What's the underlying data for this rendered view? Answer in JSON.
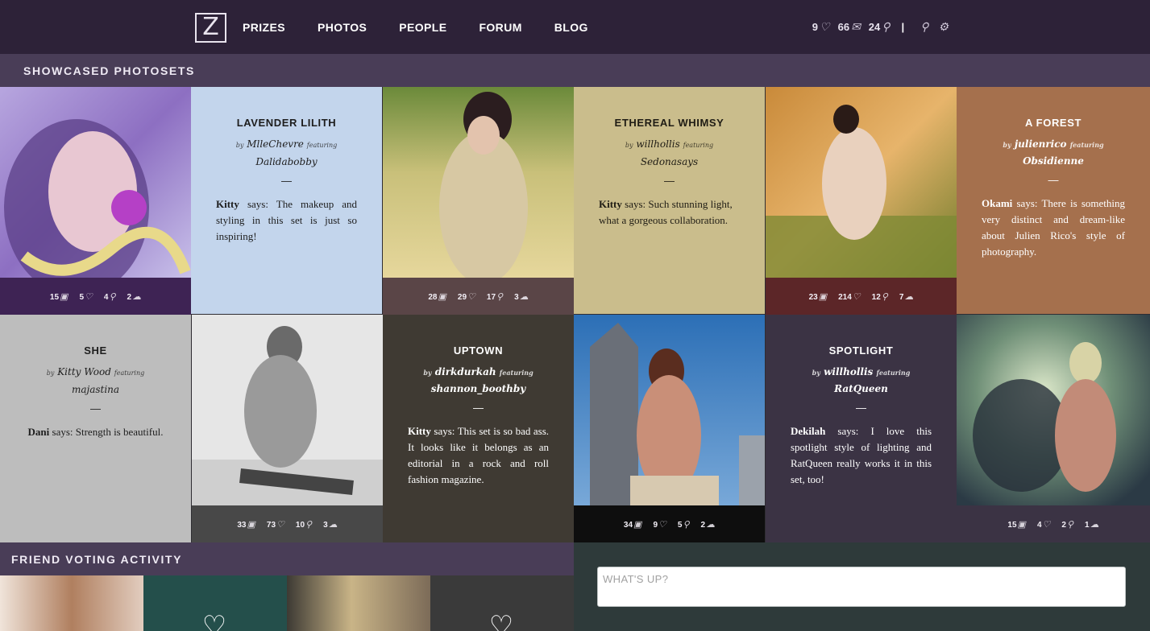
{
  "brand": {
    "logo_letter": "Z"
  },
  "nav": [
    "PRIZES",
    "PHOTOS",
    "PEOPLE",
    "FORUM",
    "BLOG"
  ],
  "user_stats": {
    "hearts": "9",
    "messages": "66",
    "people": "24"
  },
  "sections": {
    "showcase": "SHOWCASED PHOTOSETS",
    "friend_voting": "FRIEND VOTING ACTIVITY"
  },
  "photos": [
    {
      "photos": "15",
      "votes": "5",
      "followers": "4",
      "comments": "2"
    },
    {
      "photos": "28",
      "votes": "29",
      "followers": "17",
      "comments": "3"
    },
    {
      "photos": "23",
      "votes": "214",
      "followers": "12",
      "comments": "7"
    },
    {
      "photos": "33",
      "votes": "73",
      "followers": "10",
      "comments": "3"
    },
    {
      "photos": "34",
      "votes": "9",
      "followers": "5",
      "comments": "2"
    },
    {
      "photos": "15",
      "votes": "4",
      "followers": "2",
      "comments": "1"
    }
  ],
  "sets": [
    {
      "title": "LAVENDER LILITH",
      "by_word": "by",
      "author": "MlleChevre",
      "featuring_word": "featuring",
      "model": "Dalidabobby",
      "dash": "—",
      "commenter": "Kitty",
      "says_word": "says:",
      "comment": "The makeup and styling in this set is just so inspiring!"
    },
    {
      "title": "ETHEREAL WHIMSY",
      "by_word": "by",
      "author": "willhollis",
      "featuring_word": "featuring",
      "model": "Sedonasays",
      "dash": "—",
      "commenter": "Kitty",
      "says_word": "says:",
      "comment": "Such stunning light, what a gorgeous collaboration."
    },
    {
      "title": "A FOREST",
      "by_word": "by",
      "author": "julienrico",
      "featuring_word": "featuring",
      "model": "Obsidienne",
      "dash": "—",
      "commenter": "Okami",
      "says_word": "says:",
      "comment": "There is something very distinct and dream-like about Julien Rico's style of photography."
    },
    {
      "title": "SHE",
      "by_word": "by",
      "author": "Kitty Wood",
      "featuring_word": "featuring",
      "model": "majastina",
      "dash": "—",
      "commenter": "Dani",
      "says_word": "says:",
      "comment": "Strength is beautiful."
    },
    {
      "title": "UPTOWN",
      "by_word": "by",
      "author": "dirkdurkah",
      "featuring_word": "featuring",
      "model": "shannon_boothby",
      "dash": "—",
      "commenter": "Kitty",
      "says_word": "says:",
      "comment": "This set is so bad ass. It looks like it belongs as an editorial in a rock and roll fashion magazine."
    },
    {
      "title": "SPOTLIGHT",
      "by_word": "by",
      "author": "willhollis",
      "featuring_word": "featuring",
      "model": "RatQueen",
      "dash": "—",
      "commenter": "Dekilah",
      "says_word": "says:",
      "comment": "I love this spotlight style of lighting and RatQueen really works it in this set, too!"
    }
  ],
  "status": {
    "placeholder": "WHAT'S UP?"
  },
  "icons": {
    "heart": "heart-icon",
    "envelope": "envelope-icon",
    "person": "person-icon",
    "search": "search-icon",
    "settings": "gear-icon",
    "photos": "image-icon",
    "comments": "comment-icon"
  }
}
